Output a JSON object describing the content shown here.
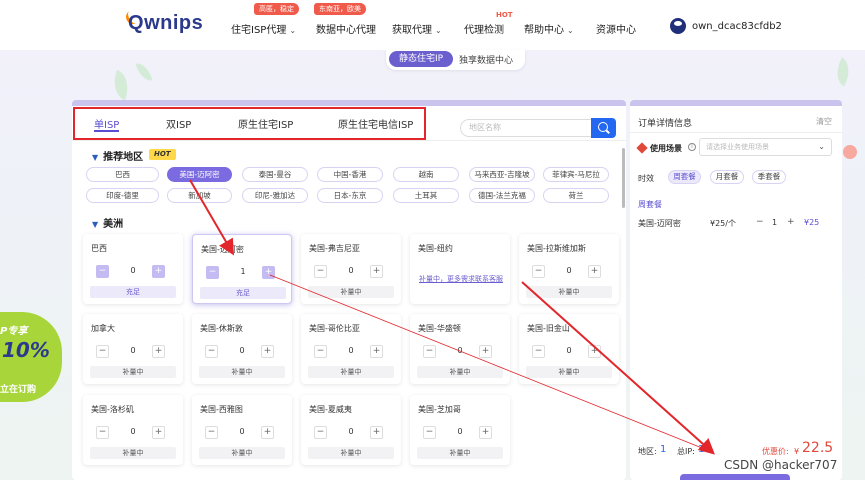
{
  "header": {
    "logo": "wnips",
    "nav": [
      {
        "label": "住宅ISP代理",
        "tag": "高匿，稳定",
        "chev": "⌄"
      },
      {
        "label": "数据中心代理",
        "tag": "东南亚，欧美"
      },
      {
        "label": "获取代理",
        "chev": "⌄"
      },
      {
        "label": "代理检测",
        "sup": "HOT"
      },
      {
        "label": "帮助中心",
        "chev": "⌄"
      },
      {
        "label": "资源中心"
      }
    ],
    "user": "own_dcac83cfdb2"
  },
  "sub_tabs": {
    "active": "静态住宅IP",
    "other": "独享数据中心"
  },
  "isp_tabs": [
    "单ISP",
    "双ISP",
    "原生住宅ISP",
    "原生住宅电信ISP"
  ],
  "search": {
    "placeholder": "地区名称"
  },
  "recommend": {
    "title": "推荐地区",
    "badge": "HOT",
    "chips": [
      "巴西",
      "美国-迈阿密",
      "泰国-曼谷",
      "中国-香港",
      "越南",
      "马来西亚-吉隆坡",
      "菲律宾-马尼拉",
      "印度-德里",
      "新加坡",
      "印尼-雅加达",
      "日本-东京",
      "土耳其",
      "德国-法兰克福",
      "荷兰"
    ],
    "active_chip": "美国-迈阿密"
  },
  "america": {
    "title": "美洲",
    "cards": [
      {
        "name": "巴西",
        "qty": "0",
        "status": "充足"
      },
      {
        "name": "美国-迈阿密",
        "qty": "1",
        "status": "充足"
      },
      {
        "name": "美国-弗吉尼亚",
        "qty": "0",
        "status": "补量中"
      },
      {
        "name": "美国-纽约",
        "note": "补量中，更多需求联系客服"
      },
      {
        "name": "美国-拉斯维加斯",
        "qty": "0",
        "status": "补量中"
      },
      {
        "name": "加拿大",
        "qty": "0",
        "status": "补量中"
      },
      {
        "name": "美国-休斯敦",
        "qty": "0",
        "status": "补量中"
      },
      {
        "name": "美国-哥伦比亚",
        "qty": "0",
        "status": "补量中"
      },
      {
        "name": "美国-华盛顿",
        "qty": "0",
        "status": "补量中"
      },
      {
        "name": "美国-旧金山",
        "qty": "0",
        "status": "补量中"
      },
      {
        "name": "美国-洛杉矶",
        "qty": "0",
        "status": "补量中"
      },
      {
        "name": "美国-西雅图",
        "qty": "0",
        "status": "补量中"
      },
      {
        "name": "美国-夏威夷",
        "qty": "0",
        "status": "补量中"
      },
      {
        "name": "美国-芝加哥",
        "qty": "0",
        "status": "补量中"
      }
    ]
  },
  "stepper": {
    "minus": "−",
    "plus": "+"
  },
  "order": {
    "title": "订单详情信息",
    "clear": "清空",
    "scene_label": "使用场景",
    "scene_placeholder": "请选择业务使用场景",
    "duration_label": "时效",
    "durations": [
      "周套餐",
      "月套餐",
      "季套餐"
    ],
    "active_duration": "周套餐",
    "period": "周套餐",
    "item": {
      "region": "美国-迈阿密",
      "price": "¥25/个",
      "qty": "1",
      "total": "¥25"
    },
    "summary": {
      "region_label": "地区:",
      "region_count": "1",
      "ip_label": "总IP:",
      "ip_count": "1",
      "discount_label": "优惠价:",
      "currency": "¥",
      "price": "22.5"
    }
  },
  "promo": {
    "line1": "P专享",
    "line2": "10%",
    "line3": "立在订购"
  },
  "watermark": "CSDN @hacker707",
  "colors": {
    "accent": "#6b5fcf",
    "primary_blue": "#2468f2",
    "annotation_red": "#e3262b",
    "price_red": "#e0483c"
  }
}
